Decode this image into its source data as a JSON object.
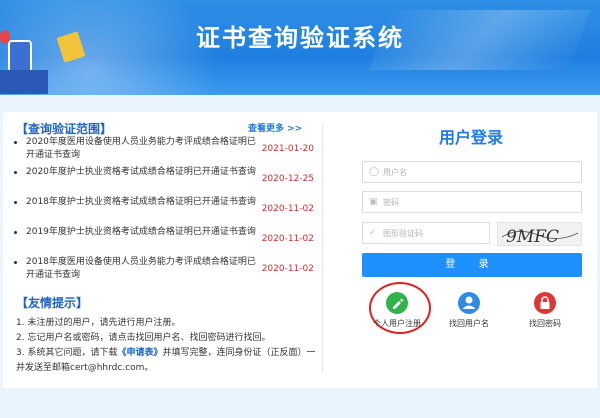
{
  "header": {
    "title": "证书查询验证系统"
  },
  "scope": {
    "title": "【查询验证范围】",
    "more_label": "查看更多 >>",
    "items": [
      {
        "text": "2020年度医用设备使用人员业务能力考评成绩合格证明已开通证书查询",
        "date": "2021-01-20"
      },
      {
        "text": "2020年度护士执业资格考试成绩合格证明已开通证书查询",
        "date": "2020-12-25"
      },
      {
        "text": "2018年度护士执业资格考试成绩合格证明已开通证书查询",
        "date": "2020-11-02"
      },
      {
        "text": "2019年度护士执业资格考试成绩合格证明已开通证书查询",
        "date": "2020-11-02"
      },
      {
        "text": "2018年度医用设备使用人员业务能力考评成绩合格证明已开通证书查询",
        "date": "2020-11-02"
      }
    ]
  },
  "tips": {
    "title": "【友情提示】",
    "line1": "1. 未注册过的用户，请先进行用户注册。",
    "line2": "2. 忘记用户名或密码，请点击找回用户名、找回密码进行找回。",
    "line3_pre": "3. 系统其它问题，请下载",
    "line3_link": "《申请表》",
    "line3_post": "并填写完整，连同身份证（正反面）一并发送至邮箱cert@hhrdc.com。"
  },
  "login": {
    "title": "用户登录",
    "username_placeholder": "用户名",
    "password_placeholder": "密码",
    "captcha_placeholder": "图形验证码",
    "captcha_text": "9MFC",
    "submit_label": "登 录",
    "register_label": "个人用户注册",
    "find_user_label": "找回用户名",
    "find_pwd_label": "找回密码"
  },
  "colors": {
    "accent": "#1e90ff",
    "date_red": "#d62a2a",
    "register_green": "#2fb34a",
    "find_pwd_red": "#e03535"
  }
}
